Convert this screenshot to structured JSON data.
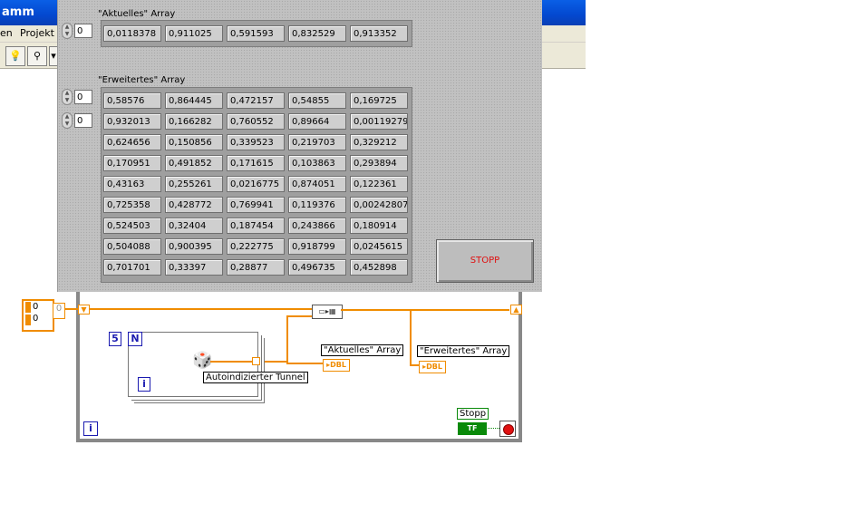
{
  "window": {
    "title": "amm",
    "menu": [
      "en",
      "Projekt"
    ]
  },
  "front_panel": {
    "aktuelles": {
      "label": "\"Aktuelles\" Array",
      "index": "0",
      "values": [
        "0,0118378",
        "0,911025",
        "0,591593",
        "0,832529",
        "0,913352"
      ]
    },
    "erweitertes": {
      "label": "\"Erweitertes\" Array",
      "index_row": "0",
      "index_col": "0",
      "rows": [
        [
          "0,58576",
          "0,864445",
          "0,472157",
          "0,54855",
          "0,169725"
        ],
        [
          "0,932013",
          "0,166282",
          "0,760552",
          "0,89664",
          "0,00119279"
        ],
        [
          "0,624656",
          "0,150856",
          "0,339523",
          "0,219703",
          "0,329212"
        ],
        [
          "0,170951",
          "0,491852",
          "0,171615",
          "0,103863",
          "0,293894"
        ],
        [
          "0,43163",
          "0,255261",
          "0,0216775",
          "0,874051",
          "0,122361"
        ],
        [
          "0,725358",
          "0,428772",
          "0,769941",
          "0,119376",
          "0,00242807"
        ],
        [
          "0,524503",
          "0,32404",
          "0,187454",
          "0,243866",
          "0,180914"
        ],
        [
          "0,504088",
          "0,900395",
          "0,222775",
          "0,918799",
          "0,0245615"
        ],
        [
          "0,701701",
          "0,33397",
          "0,28877",
          "0,496735",
          "0,452898"
        ]
      ]
    },
    "stop_label": "STOPP"
  },
  "block_diagram": {
    "init_ctrl_values": [
      "0",
      "0"
    ],
    "init_index": "0",
    "n_const": "5",
    "n_label": "N",
    "loop_i": "i",
    "inner_i": "i",
    "tunnel_label": "Autoindizierter Tunnel",
    "ind_aktuelles": "\"Aktuelles\" Array",
    "ind_erweitertes": "\"Erweitertes\" Array",
    "dbl": "DBL",
    "stop_term_label": "Stopp",
    "tf": "TF"
  }
}
